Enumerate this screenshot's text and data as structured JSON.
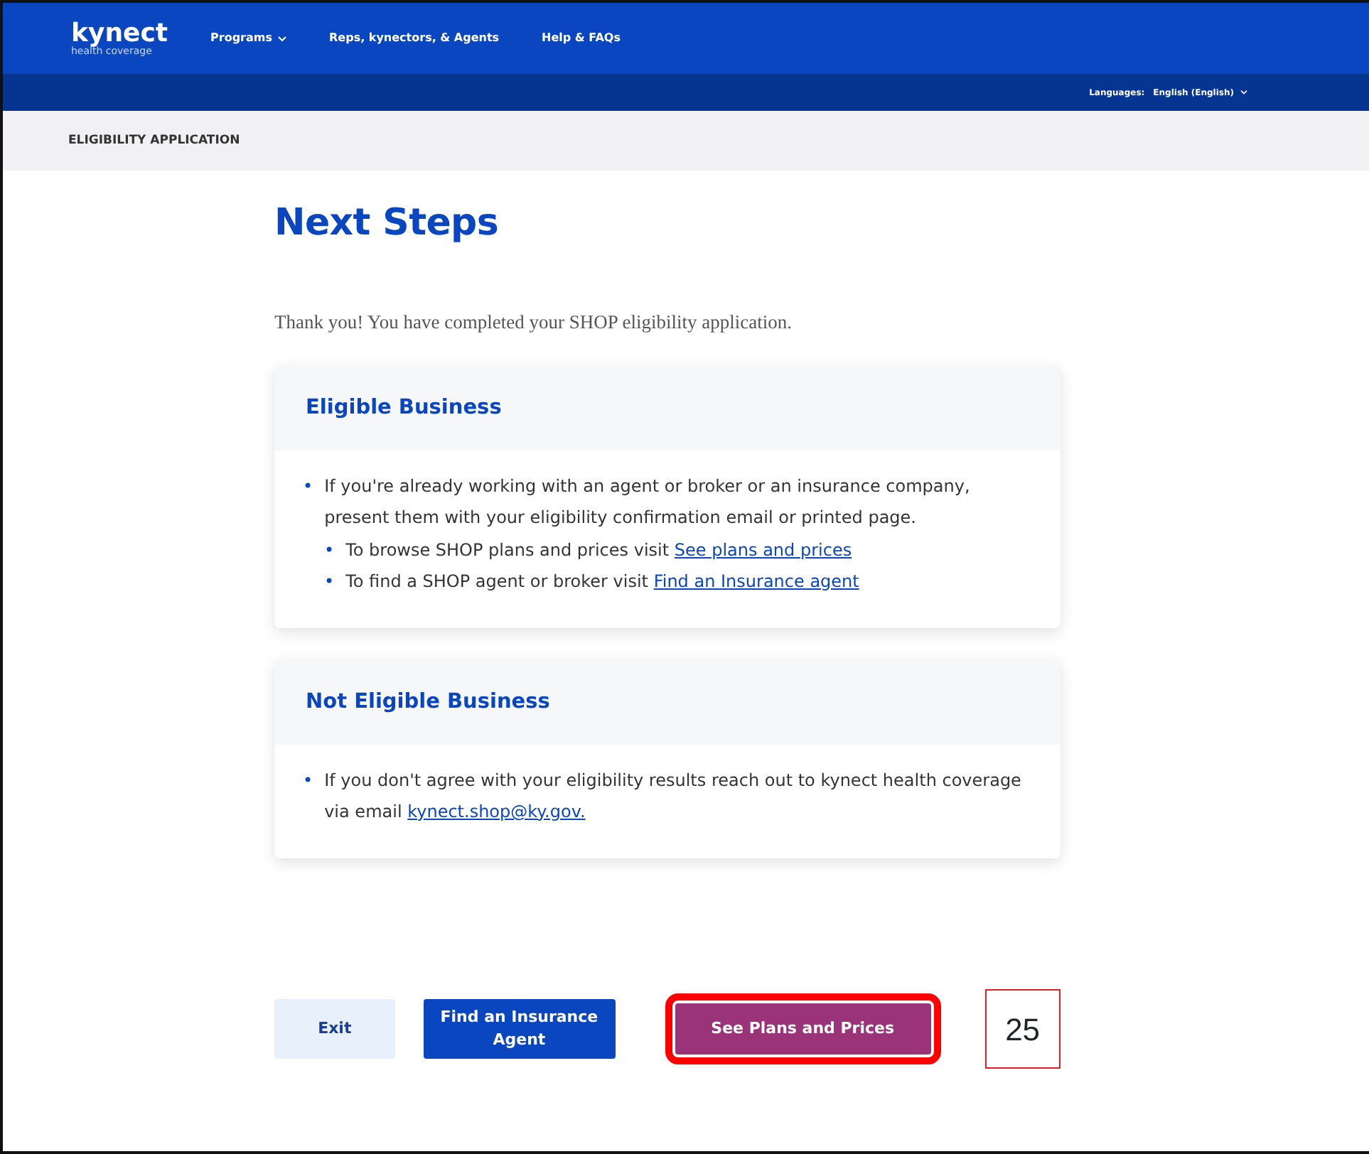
{
  "header": {
    "logo": "kynect",
    "logo_tagline": "health coverage",
    "nav": [
      {
        "label": "Programs",
        "dropdown": true
      },
      {
        "label": "Reps, kynectors, & Agents",
        "dropdown": false
      },
      {
        "label": "Help & FAQs",
        "dropdown": false
      }
    ],
    "language_label": "Languages:",
    "language_value": "English (English)"
  },
  "breadcrumb": "ELIGIBILITY APPLICATION",
  "title": "Next Steps",
  "intro": "Thank you! You have completed your SHOP eligibility application.",
  "cards": [
    {
      "title": "Eligible Business",
      "items": [
        {
          "marker": "•",
          "text": "If you're already working with an agent or broker or an insurance company, present them with your eligibility confirmation email or printed page.",
          "children": [
            {
              "marker": "•",
              "text": "To browse SHOP plans and prices visit ",
              "link": "See plans and prices"
            },
            {
              "marker": "•",
              "text": "To find a SHOP agent or broker visit ",
              "link": "Find an Insurance agent"
            }
          ]
        }
      ]
    },
    {
      "title": "Not Eligible Business",
      "items": [
        {
          "marker": "•",
          "text": "If you don't agree with your eligibility results reach out to kynect health coverage via email ",
          "link": "kynect.shop@ky.gov."
        }
      ]
    }
  ],
  "buttons": [
    {
      "label": "Exit",
      "kind": "light",
      "highlighted": false
    },
    {
      "label": "Find an Insurance Agent",
      "kind": "primary",
      "highlighted": false
    },
    {
      "label": "See Plans and Prices",
      "kind": "purple",
      "highlighted": true
    }
  ],
  "callout": "25"
}
